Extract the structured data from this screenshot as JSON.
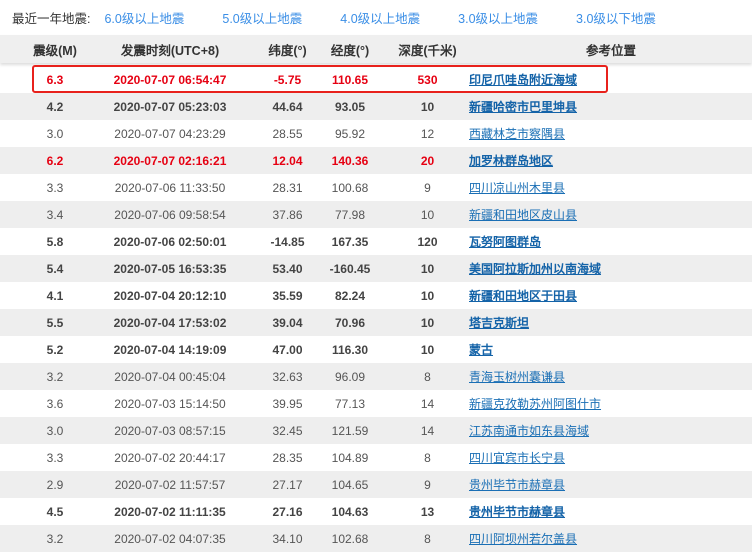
{
  "filter": {
    "label": "最近一年地震:",
    "links": [
      "6.0级以上地震",
      "5.0级以上地震",
      "4.0级以上地震",
      "3.0级以上地震",
      "3.0级以下地震"
    ]
  },
  "headers": [
    "震级(M)",
    "发震时刻(UTC+8)",
    "纬度(°)",
    "经度(°)",
    "深度(千米)",
    "参考位置"
  ],
  "rows": [
    [
      "6.3",
      "2020-07-07 06:54:47",
      "-5.75",
      "110.65",
      "530",
      "印尼爪哇岛附近海域"
    ],
    [
      "4.2",
      "2020-07-07 05:23:03",
      "44.64",
      "93.05",
      "10",
      "新疆哈密市巴里坤县"
    ],
    [
      "3.0",
      "2020-07-07 04:23:29",
      "28.55",
      "95.92",
      "12",
      "西藏林芝市察隅县"
    ],
    [
      "6.2",
      "2020-07-07 02:16:21",
      "12.04",
      "140.36",
      "20",
      "加罗林群岛地区"
    ],
    [
      "3.3",
      "2020-07-06 11:33:50",
      "28.31",
      "100.68",
      "9",
      "四川凉山州木里县"
    ],
    [
      "3.4",
      "2020-07-06 09:58:54",
      "37.86",
      "77.98",
      "10",
      "新疆和田地区皮山县"
    ],
    [
      "5.8",
      "2020-07-06 02:50:01",
      "-14.85",
      "167.35",
      "120",
      "瓦努阿图群岛"
    ],
    [
      "5.4",
      "2020-07-05 16:53:35",
      "53.40",
      "-160.45",
      "10",
      "美国阿拉斯加州以南海域"
    ],
    [
      "4.1",
      "2020-07-04 20:12:10",
      "35.59",
      "82.24",
      "10",
      "新疆和田地区于田县"
    ],
    [
      "5.5",
      "2020-07-04 17:53:02",
      "39.04",
      "70.96",
      "10",
      "塔吉克斯坦"
    ],
    [
      "5.2",
      "2020-07-04 14:19:09",
      "47.00",
      "116.30",
      "10",
      "蒙古"
    ],
    [
      "3.2",
      "2020-07-04 00:45:04",
      "32.63",
      "96.09",
      "8",
      "青海玉树州囊谦县"
    ],
    [
      "3.6",
      "2020-07-03 15:14:50",
      "39.95",
      "77.13",
      "14",
      "新疆克孜勒苏州阿图什市"
    ],
    [
      "3.0",
      "2020-07-03 08:57:15",
      "32.45",
      "121.59",
      "14",
      "江苏南通市如东县海域"
    ],
    [
      "3.3",
      "2020-07-02 20:44:17",
      "28.35",
      "104.89",
      "8",
      "四川宜宾市长宁县"
    ],
    [
      "2.9",
      "2020-07-02 11:57:57",
      "27.17",
      "104.65",
      "9",
      "贵州毕节市赫章县"
    ],
    [
      "4.5",
      "2020-07-02 11:11:35",
      "27.16",
      "104.63",
      "13",
      "贵州毕节市赫章县"
    ],
    [
      "3.2",
      "2020-07-02 04:07:35",
      "34.10",
      "102.68",
      "8",
      "四川阿坝州若尔盖县"
    ]
  ]
}
